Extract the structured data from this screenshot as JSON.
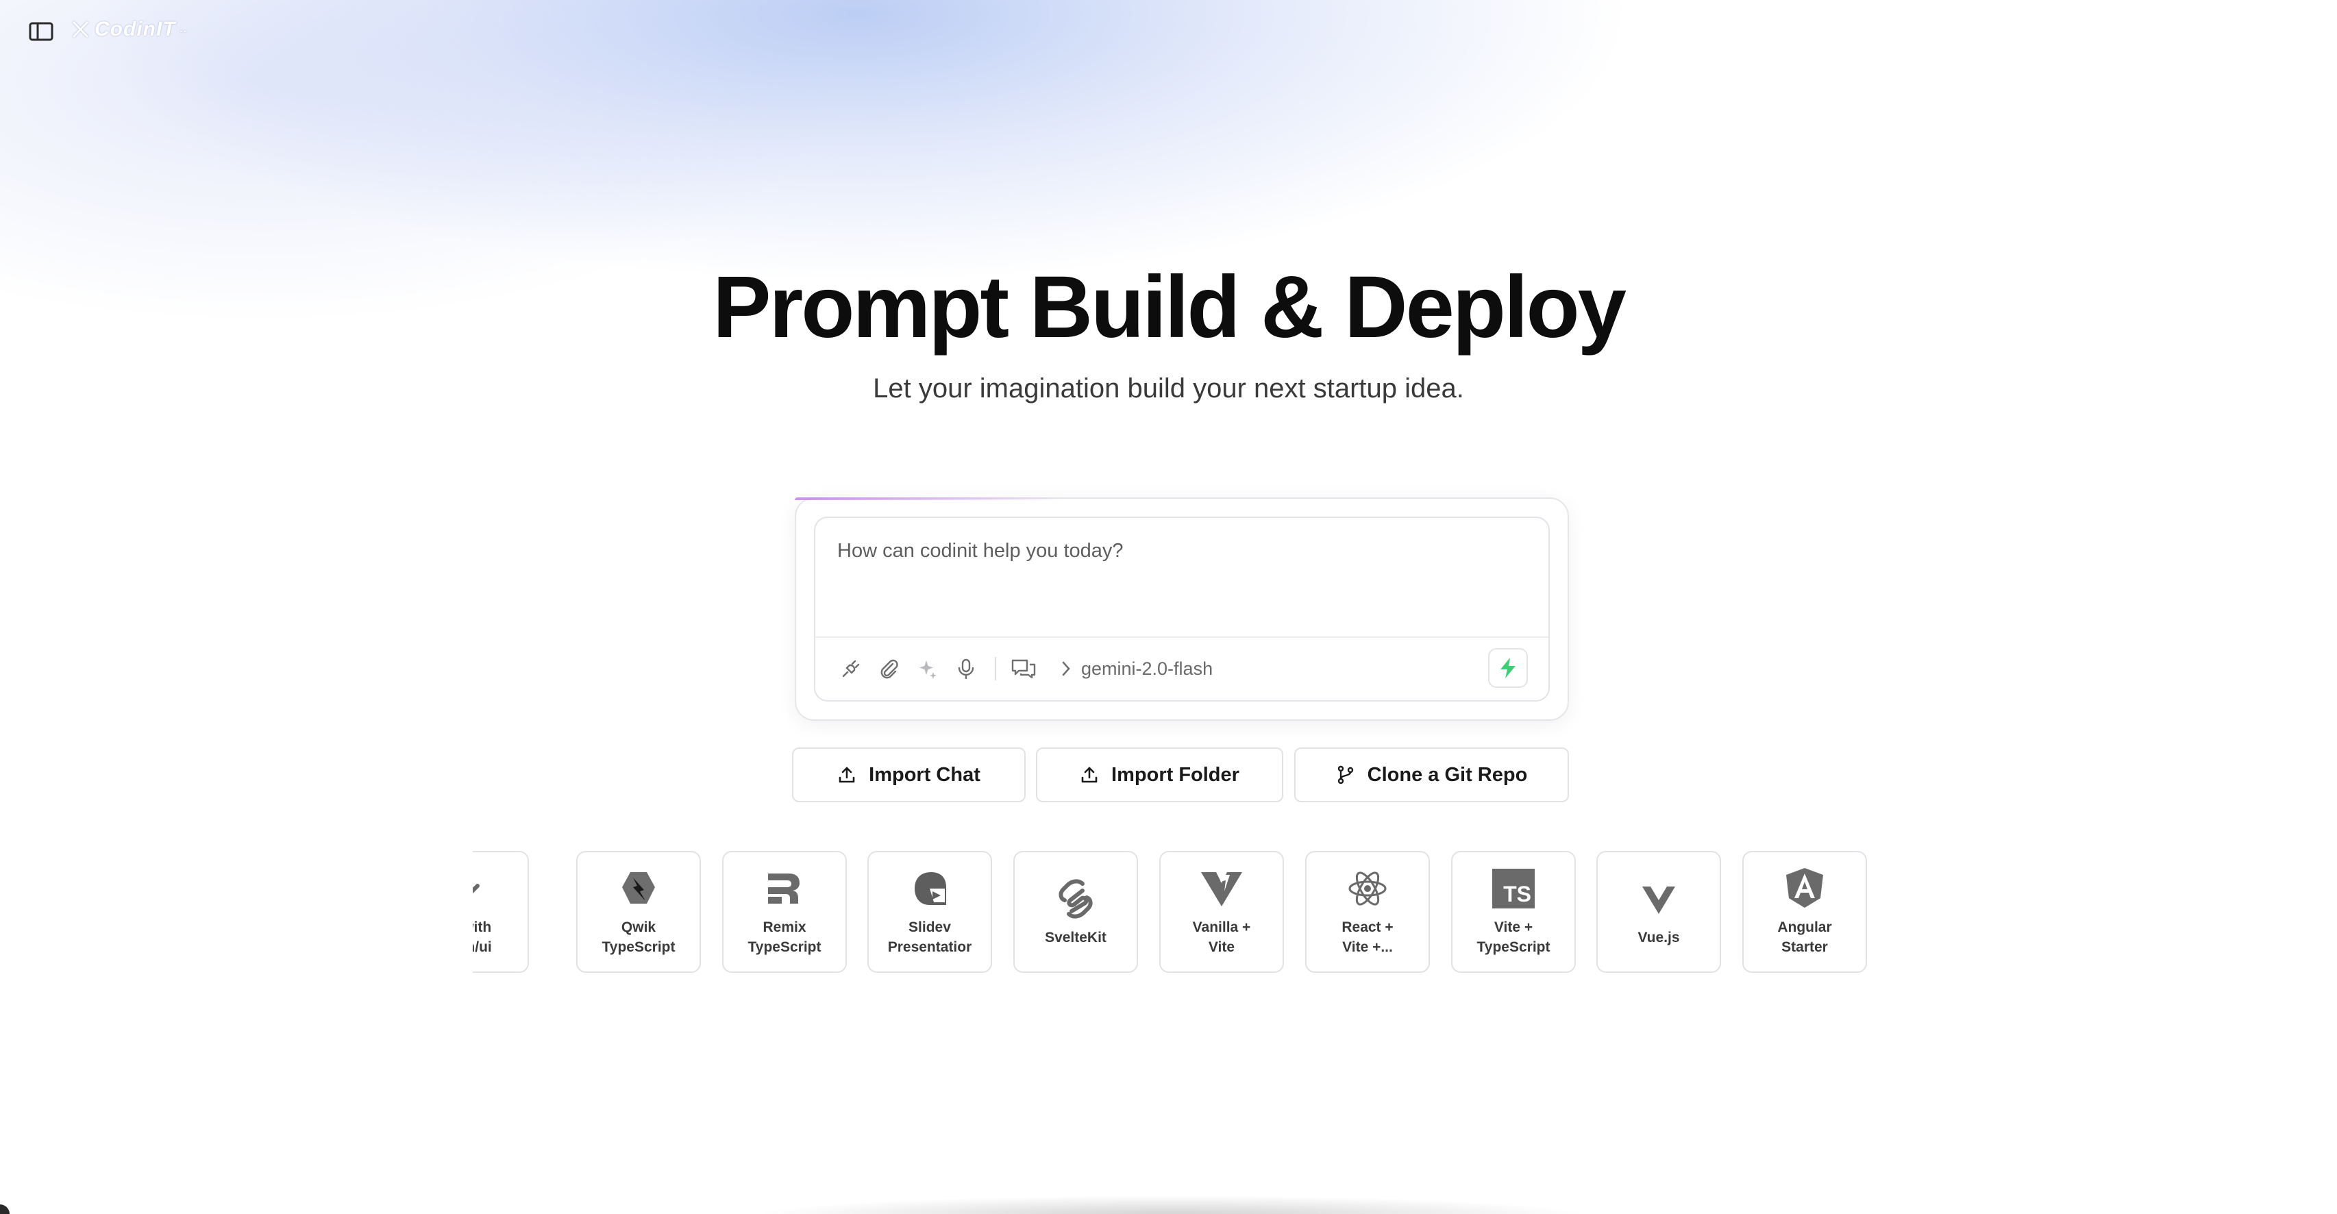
{
  "app": {
    "logo_text": "CodinIT",
    "logo_suffix": ".."
  },
  "hero": {
    "title": "Prompt Build & Deploy",
    "subtitle": "Let your imagination build your next startup idea."
  },
  "prompt": {
    "placeholder": "How can codinit help you today?",
    "model": "gemini-2.0-flash",
    "icons": [
      "plug-icon",
      "paperclip-icon",
      "sparkles-icon",
      "microphone-icon",
      "chat-icon"
    ],
    "send_icon": "lightning-icon",
    "accent_color": "#3ccf74"
  },
  "actions": [
    {
      "label": "Import Chat",
      "icon": "upload-icon"
    },
    {
      "label": "Import Folder",
      "icon": "upload-icon"
    },
    {
      "label": "Clone a Git Repo",
      "icon": "git-branch-icon"
    }
  ],
  "templates": [
    {
      "label": "ite with\nadcn/ui",
      "icon": "shadcn-icon"
    },
    {
      "label": "Qwik\nTypeScript",
      "icon": "qwik-icon"
    },
    {
      "label": "Remix\nTypeScript",
      "icon": "remix-icon"
    },
    {
      "label": "Slidev\nPresentatior",
      "icon": "slidev-icon"
    },
    {
      "label": "SvelteKit",
      "icon": "svelte-icon"
    },
    {
      "label": "Vanilla +\nVite",
      "icon": "vite-icon"
    },
    {
      "label": "React +\nVite +...",
      "icon": "react-icon"
    },
    {
      "label": "Vite +\nTypeScript",
      "icon": "typescript-icon"
    },
    {
      "label": "Vue.js",
      "icon": "vue-icon"
    },
    {
      "label": "Angular\nStarter",
      "icon": "angular-icon"
    }
  ],
  "ts_badge": "TS"
}
